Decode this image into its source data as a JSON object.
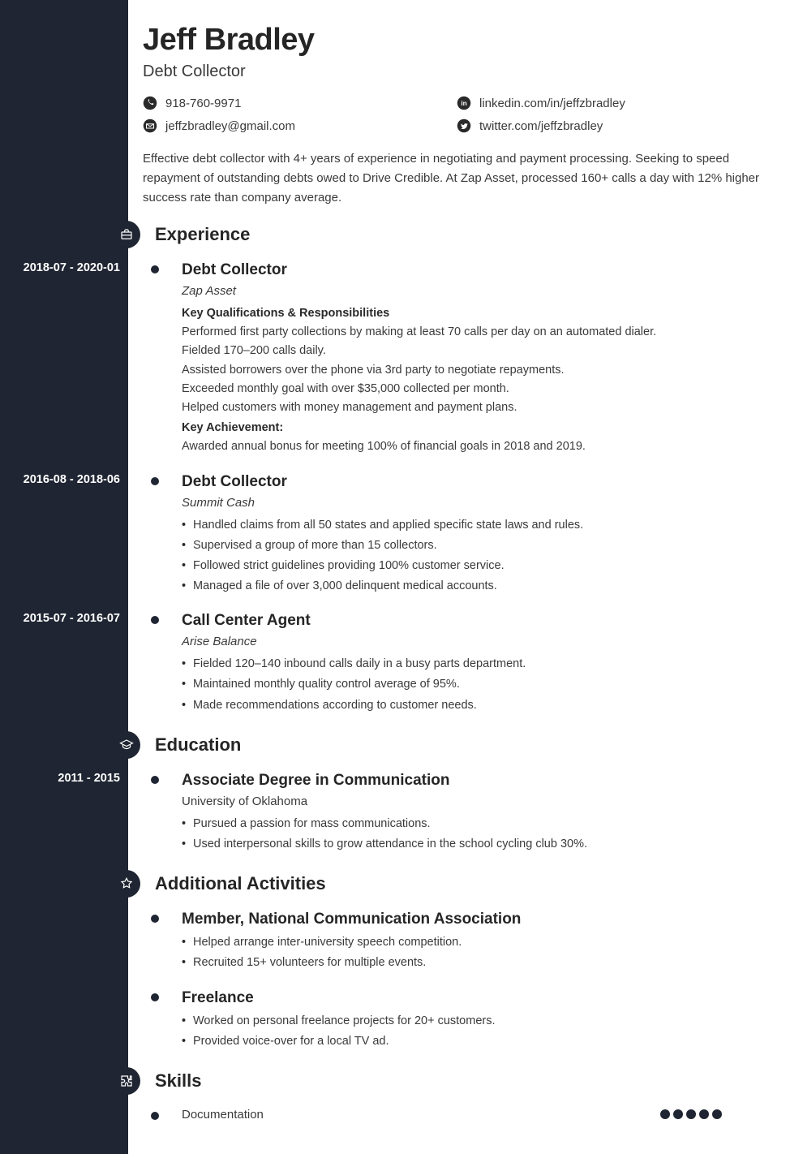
{
  "name": "Jeff Bradley",
  "role": "Debt Collector",
  "contacts": {
    "phone": "918-760-9971",
    "email": "jeffzbradley@gmail.com",
    "linkedin": "linkedin.com/in/jeffzbradley",
    "twitter": "twitter.com/jeffzbradley"
  },
  "summary": "Effective debt collector with 4+ years of experience in negotiating and payment processing. Seeking to speed repayment of outstanding debts owed to Drive Credible. At Zap Asset, processed 160+ calls a day with 12% higher success rate than company average.",
  "sections": {
    "experience": {
      "title": "Experience",
      "items": [
        {
          "date": "2018-07 - 2020-01",
          "title": "Debt Collector",
          "sub": "Zap Asset",
          "qual_header": "Key Qualifications & Responsibilities",
          "lines": [
            "Performed first party collections by making at least 70 calls per day on an automated dialer.",
            "Fielded 170–200 calls daily.",
            "Assisted borrowers over the phone via 3rd party to negotiate repayments.",
            "Exceeded monthly goal with over $35,000 collected per month.",
            "Helped customers with money management and payment plans."
          ],
          "ach_header": "Key Achievement:",
          "ach": "Awarded annual bonus for meeting 100% of financial goals in 2018 and 2019."
        },
        {
          "date": "2016-08 - 2018-06",
          "title": "Debt Collector",
          "sub": "Summit Cash",
          "bullets": [
            "Handled claims from all 50 states and applied specific state laws and rules.",
            "Supervised a group of more than 15 collectors.",
            "Followed strict guidelines providing 100% customer service.",
            "Managed a file of over 3,000 delinquent medical accounts."
          ]
        },
        {
          "date": "2015-07 - 2016-07",
          "title": "Call Center Agent",
          "sub": "Arise Balance",
          "bullets": [
            "Fielded 120–140 inbound calls daily in a busy parts department.",
            "Maintained monthly quality control average of 95%.",
            "Made recommendations according to customer needs."
          ]
        }
      ]
    },
    "education": {
      "title": "Education",
      "items": [
        {
          "date": "2011 - 2015",
          "title": "Associate Degree in Communication",
          "sub": "University of Oklahoma",
          "bullets": [
            "Pursued a passion for mass communications.",
            "Used interpersonal skills to grow attendance in the school cycling club 30%."
          ]
        }
      ]
    },
    "activities": {
      "title": "Additional Activities",
      "items": [
        {
          "title": "Member, National Communication Association",
          "bullets": [
            "Helped arrange inter-university speech competition.",
            "Recruited 15+ volunteers for multiple events."
          ]
        },
        {
          "title": "Freelance",
          "bullets": [
            "Worked on personal freelance projects for 20+ customers.",
            "Provided voice-over for a local TV ad."
          ]
        }
      ]
    },
    "skills": {
      "title": "Skills",
      "items": [
        {
          "name": "Documentation",
          "level": 5
        }
      ]
    }
  }
}
